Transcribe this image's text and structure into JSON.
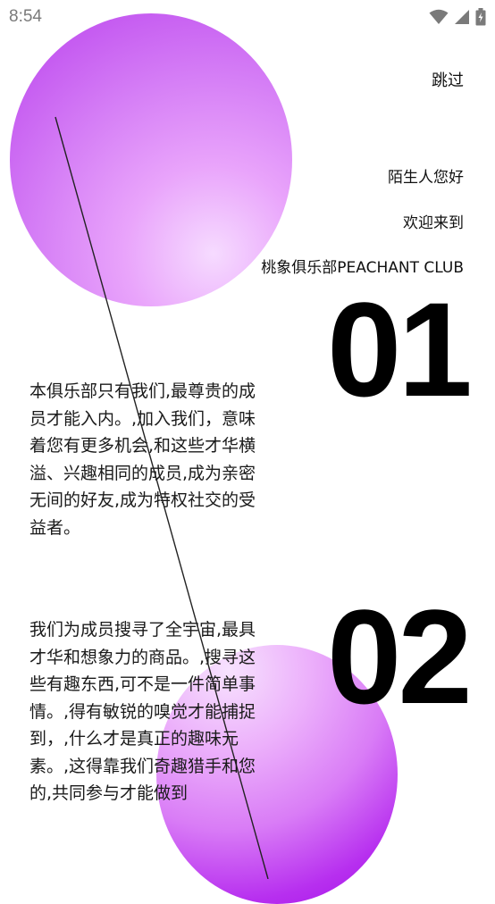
{
  "status_bar": {
    "time": "8:54",
    "icons": [
      "wifi-icon",
      "signal-icon",
      "battery-charging-icon"
    ]
  },
  "header": {
    "skip_label": "跳过"
  },
  "greeting": {
    "line1": "陌生人您好",
    "line2": "欢迎来到",
    "line3": "桃象俱乐部PEACHANT CLUB"
  },
  "sections": [
    {
      "number": "01",
      "text": "本俱乐部只有我们,最尊贵的成\n员才能入内。,加入我们，意味\n着您有更多机会,和这些才华横\n溢、兴趣相同的成员,成为亲密\n无间的好友,成为特权社交的受\n益者。"
    },
    {
      "number": "02",
      "text": "我们为成员搜寻了全宇宙,最具\n才华和想象力的商品。,搜寻这\n些有趣东西,可不是一件简单事\n情。,得有敏锐的嗅觉才能捕捉\n到，,什么才是真正的趣味元\n素。,这得靠我们奇趣猎手和您\n的,共同参与才能做到"
    }
  ],
  "colors": {
    "orb_top": "#c65df1",
    "orb_bottom": "#a40ee8",
    "text": "#111111",
    "status_text": "#7a7a7a"
  }
}
